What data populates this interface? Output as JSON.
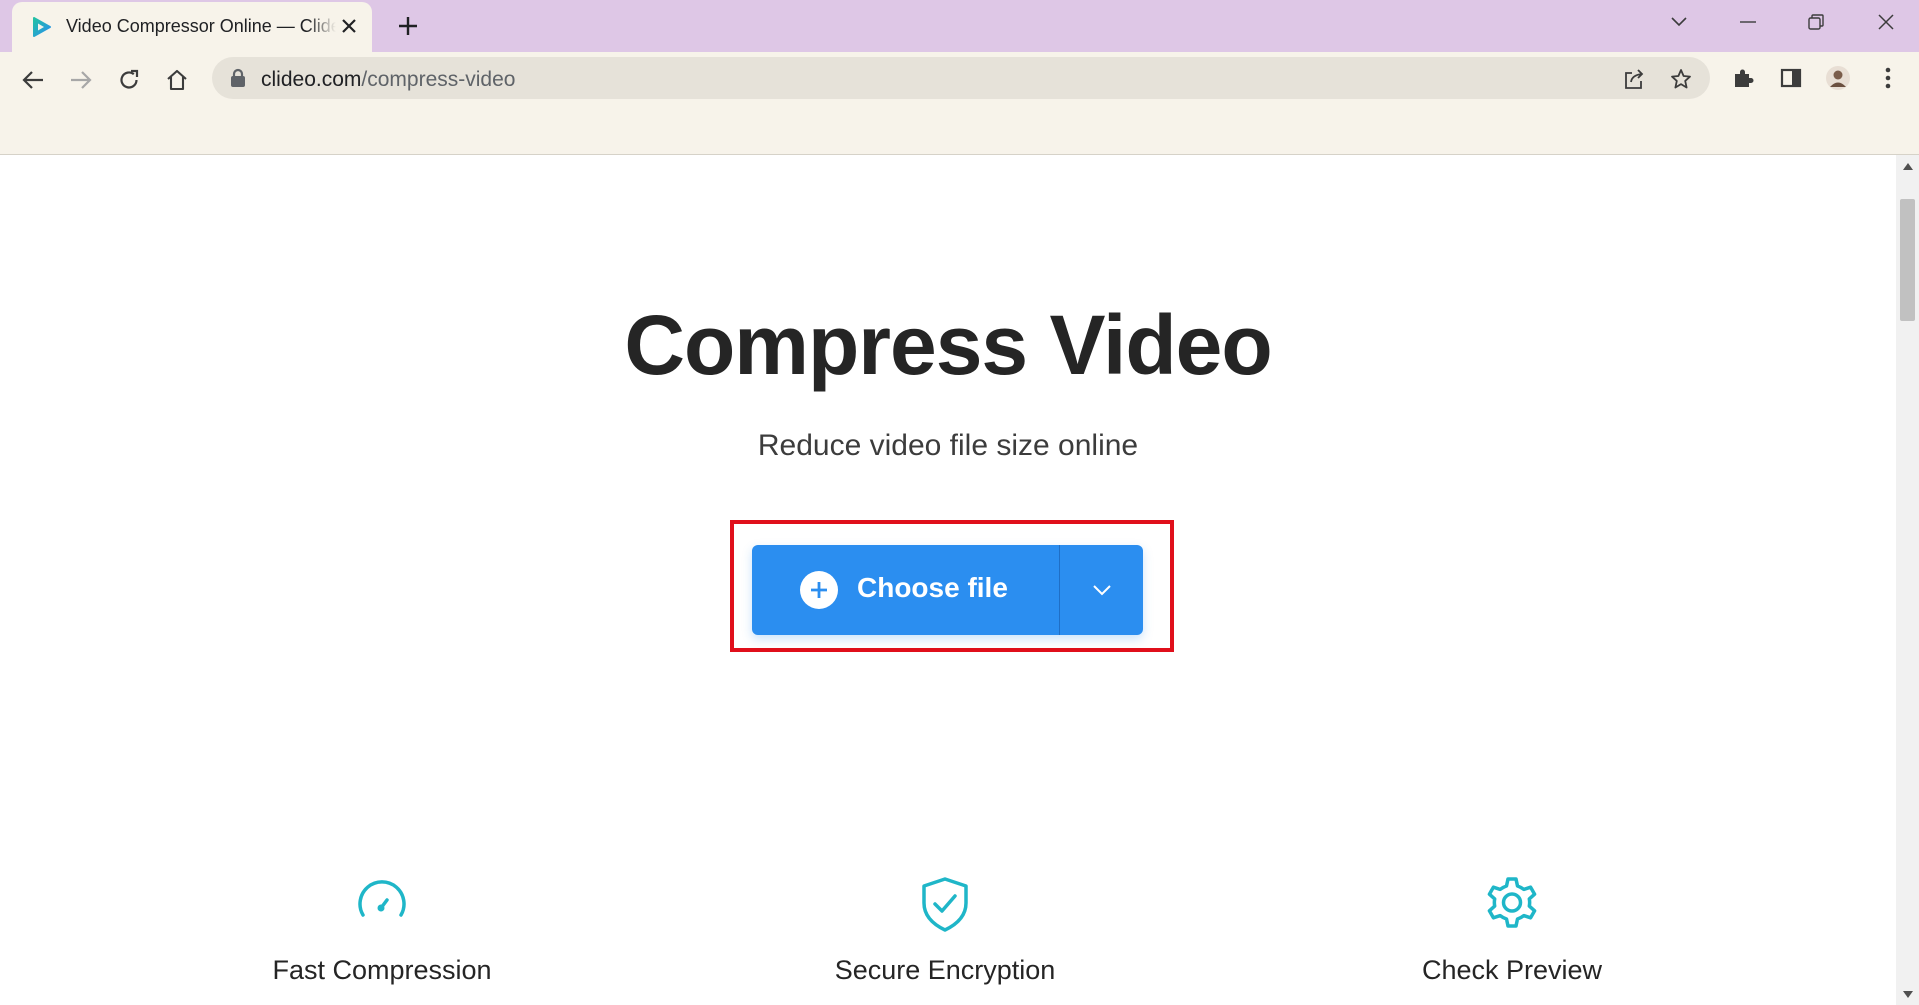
{
  "browser": {
    "tab": {
      "title": "Video Compressor Online — Clideo",
      "favicon": "clideo-play-icon"
    },
    "new_tab_label": "+",
    "address_bar": {
      "domain": "clideo.com",
      "path": "/compress-video"
    },
    "window_controls": [
      "tab-search-icon",
      "minimize-icon",
      "restore-icon",
      "close-icon"
    ],
    "toolbar_icons": [
      "share-icon",
      "bookmark-star-icon",
      "extensions-icon",
      "side-panel-icon",
      "profile-avatar",
      "menu-icon"
    ]
  },
  "page": {
    "headline": "Compress Video",
    "subheadline": "Reduce video file size online",
    "upload_button": {
      "label": "Choose file",
      "color": "#2b8ef0"
    },
    "highlight_color": "#e00f1b",
    "features": [
      {
        "label": "Fast Compression",
        "icon": "speedometer-icon"
      },
      {
        "label": "Secure Encryption",
        "icon": "shield-check-icon"
      },
      {
        "label": "Check Preview",
        "icon": "gear-icon"
      }
    ],
    "accent_color": "#1fb6c8"
  }
}
